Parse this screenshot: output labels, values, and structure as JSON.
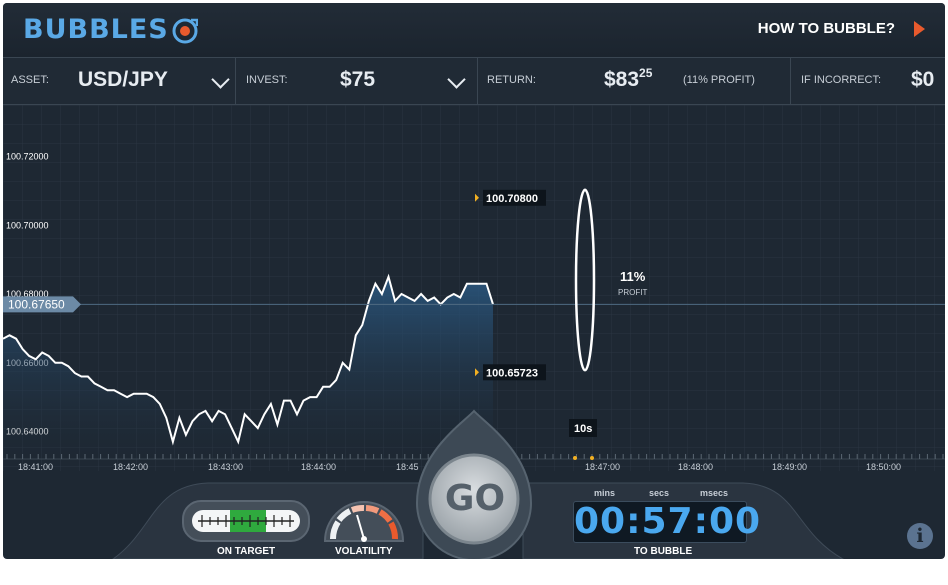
{
  "header": {
    "logo_text": "BUBBLES",
    "how_to_label": "HOW TO BUBBLE?"
  },
  "toolbar": {
    "asset_label": "ASSET:",
    "asset_value": "USD/JPY",
    "invest_label": "INVEST:",
    "invest_value": "$75",
    "return_label": "RETURN:",
    "return_whole": "$83",
    "return_cents": "25",
    "return_profit": "(11% PROFIT)",
    "incorrect_label": "IF INCORRECT:",
    "incorrect_value": "$0"
  },
  "chart": {
    "current_price": "100.67650",
    "upper_bound": "100.70800",
    "lower_bound": "100.65723",
    "profit_percent": "11%",
    "profit_label": "PROFIT",
    "countdown_tag": "10s"
  },
  "chart_data": {
    "type": "line",
    "title": "",
    "xlabel": "",
    "ylabel": "",
    "y_ticks": [
      "100.72000",
      "100.70000",
      "100.68000",
      "100.66000",
      "100.64000"
    ],
    "x_ticks": [
      "18:41:00",
      "18:42:00",
      "18:43:00",
      "18:44:00",
      "18:45",
      "18:47:00",
      "18:48:00",
      "18:49:00",
      "18:50:00"
    ],
    "ylim": [
      100.632,
      100.735
    ],
    "series": [
      {
        "values": [
          100.667,
          100.668,
          100.667,
          100.664,
          100.662,
          100.661,
          100.663,
          100.662,
          100.66,
          100.66,
          100.659,
          100.657,
          100.656,
          100.656,
          100.654,
          100.653,
          100.652,
          100.652,
          100.651,
          100.65,
          100.651,
          100.651,
          100.651,
          100.65,
          100.648,
          100.644,
          100.637,
          100.644,
          100.639,
          100.643,
          100.645,
          100.646,
          100.643,
          100.646,
          100.645,
          100.641,
          100.637,
          100.645,
          100.643,
          100.641,
          100.645,
          100.648,
          100.642,
          100.649,
          100.649,
          100.645,
          100.649,
          100.65,
          100.65,
          100.653,
          100.653,
          100.655,
          100.66,
          100.658,
          100.668,
          100.671,
          100.678,
          100.683,
          100.68,
          100.685,
          100.678,
          100.68,
          100.679,
          100.678,
          100.68,
          100.678,
          100.679,
          100.677,
          100.679,
          100.68,
          100.679,
          100.683,
          100.683,
          100.683,
          100.683,
          100.677
        ]
      }
    ],
    "bubble": {
      "upper": 100.708,
      "lower": 100.65723,
      "profit_percent": 11
    }
  },
  "bottom": {
    "go_label": "GO",
    "on_target_label": "ON TARGET",
    "volatility_label": "VOLATILITY",
    "timer_value": "00:57:00",
    "timer_units": [
      "mins",
      "secs",
      "msecs"
    ],
    "to_bubble_label": "TO BUBBLE",
    "info_glyph": "i"
  },
  "colors": {
    "accent_blue": "#4aa8ef",
    "logo_blue": "#5aa9e6",
    "arrow_orange": "#e85a2d",
    "marker_yellow": "#f2b022",
    "on_target_green": "#2faa3e"
  },
  "icons": {
    "logo": "target-icon",
    "how_to": "play-arrow-icon",
    "dropdown": "chevron-down-icon",
    "info": "info-icon"
  }
}
